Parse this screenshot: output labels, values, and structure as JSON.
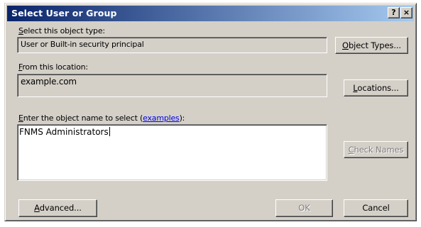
{
  "window": {
    "title": "Select User or Group",
    "help_label": "?",
    "close_label": "×"
  },
  "object_type": {
    "label_first": "S",
    "label_rest": "elect this object type:",
    "value": "User or Built-in security principal",
    "button_first": "O",
    "button_rest": "bject Types..."
  },
  "location": {
    "label_first": "F",
    "label_rest": "rom this location:",
    "value": "example.com",
    "button_first": "L",
    "button_rest": "ocations..."
  },
  "object_name": {
    "label_first": "E",
    "label_mid": "nter the object name to select (",
    "label_link": "examples",
    "label_end": "):",
    "value": "FNMS Administrators",
    "check_button_first": "C",
    "check_button_rest": "heck Names"
  },
  "footer": {
    "advanced_first": "A",
    "advanced_rest": "dvanced...",
    "ok_label": "OK",
    "cancel_label": "Cancel"
  }
}
